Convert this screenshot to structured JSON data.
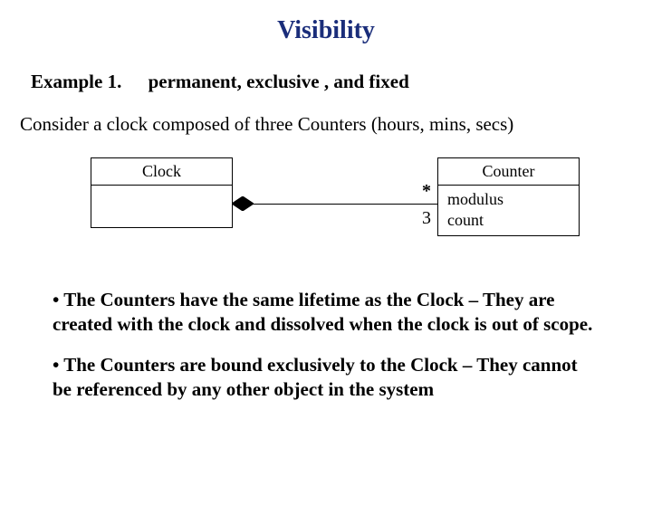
{
  "title": "Visibility",
  "example": {
    "label": "Example 1.",
    "desc": "permanent, exclusive , and fixed"
  },
  "consider": "Consider a clock composed of three Counters (hours, mins, secs)",
  "uml": {
    "clock": {
      "name": "Clock"
    },
    "counter": {
      "name": "Counter",
      "attr1": "modulus",
      "attr2": "count"
    },
    "mult_top": "*",
    "mult_bottom": "3"
  },
  "bullets": {
    "b1_lead": "• The Counters have the same lifetime as the Clock – They are created with the clock and dissolved when the clock is out of scope.",
    "b2_lead": "• The Counters are bound exclusively to the Clock – They cannot be referenced by any other object in the system"
  }
}
